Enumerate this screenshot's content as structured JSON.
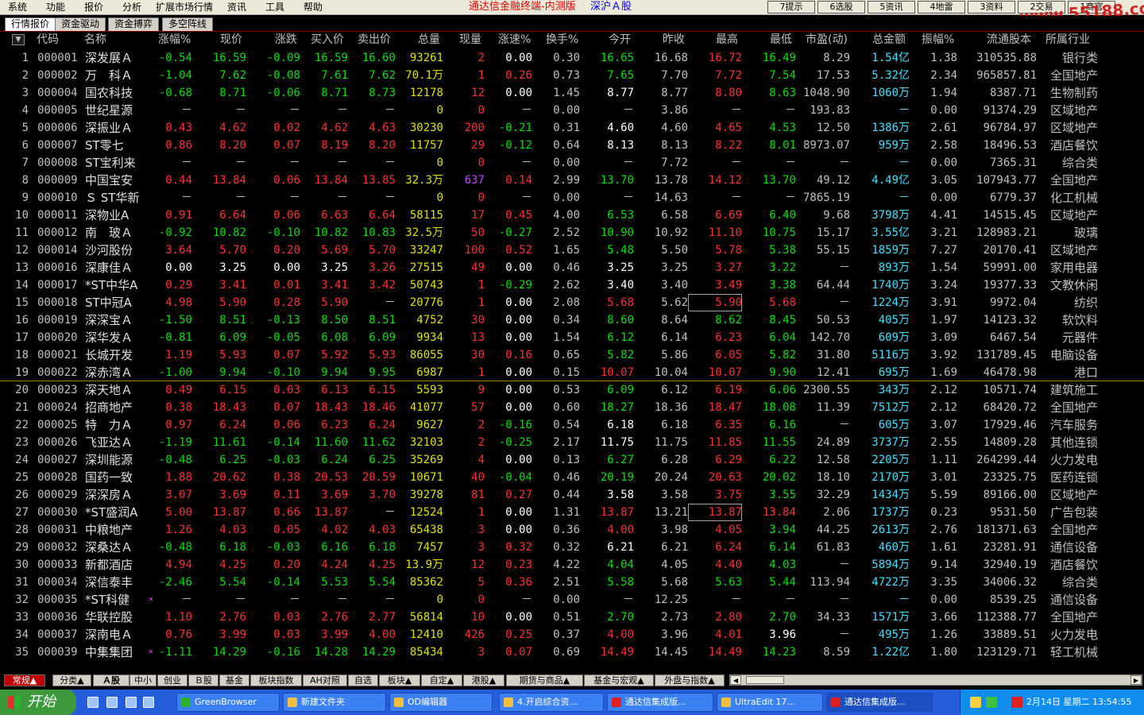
{
  "menu": [
    "系统",
    "功能",
    "报价",
    "分析",
    "扩展市场行情",
    "资讯",
    "工具",
    "帮助"
  ],
  "app_title": "通达信金融终端-内测版",
  "app_market": "深沪Ａ股",
  "top_buttons": [
    "7提示",
    "6选股",
    "5资讯",
    "4地雷",
    "3资料",
    "2交易",
    "1商官"
  ],
  "watermark": "www.55188.com",
  "top_tabs": [
    "行情报价",
    "资金驱动",
    "资金搏弈",
    "多空阵线"
  ],
  "columns": [
    "代码",
    "名称",
    "涨幅%",
    "现价",
    "涨跌",
    "买入价",
    "卖出价",
    "总量",
    "现量",
    "涨速%",
    "换手%",
    "今开",
    "昨收",
    "最高",
    "最低",
    "市盈(动)",
    "总金额",
    "振幅%",
    "流通股本",
    "所属行业"
  ],
  "sort_icon": "▼",
  "rows": [
    [
      "1",
      "000001",
      "深发展Ａ",
      "",
      "-0.54",
      "16.59",
      "-0.09",
      "16.59",
      "16.60",
      "93261",
      "2",
      "0.00",
      "0.30",
      "16.65",
      "16.68",
      "16.72",
      "16.49",
      "8.29",
      "1.54亿",
      "1.38",
      "310535.88",
      "银行类"
    ],
    [
      "2",
      "000002",
      "万　科Ａ",
      "",
      "-1.04",
      "7.62",
      "-0.08",
      "7.61",
      "7.62",
      "70.1万",
      "1",
      "0.26",
      "0.73",
      "7.65",
      "7.70",
      "7.72",
      "7.54",
      "17.53",
      "5.32亿",
      "2.34",
      "965857.81",
      "全国地产"
    ],
    [
      "3",
      "000004",
      "国农科技",
      "",
      "-0.68",
      "8.71",
      "-0.06",
      "8.71",
      "8.73",
      "12178",
      "12",
      "0.00",
      "1.45",
      "8.77",
      "8.77",
      "8.80",
      "8.63",
      "1048.90",
      "1060万",
      "1.94",
      "8387.71",
      "生物制药"
    ],
    [
      "4",
      "000005",
      "世纪星源",
      "",
      "－",
      "－",
      "－",
      "－",
      "－",
      "0",
      "0",
      "－",
      "0.00",
      "－",
      "3.86",
      "－",
      "－",
      "193.83",
      "－",
      "0.00",
      "91374.29",
      "区域地产"
    ],
    [
      "5",
      "000006",
      "深振业Ａ",
      "",
      "0.43",
      "4.62",
      "0.02",
      "4.62",
      "4.63",
      "30230",
      "200",
      "-0.21",
      "0.31",
      "4.60",
      "4.60",
      "4.65",
      "4.53",
      "12.50",
      "1386万",
      "2.61",
      "96784.97",
      "区域地产"
    ],
    [
      "6",
      "000007",
      "ST零七",
      "",
      "0.86",
      "8.20",
      "0.07",
      "8.19",
      "8.20",
      "11757",
      "29",
      "-0.12",
      "0.64",
      "8.13",
      "8.13",
      "8.22",
      "8.01",
      "8973.07",
      "959万",
      "2.58",
      "18496.53",
      "酒店餐饮"
    ],
    [
      "7",
      "000008",
      "ST宝利来",
      "",
      "－",
      "－",
      "－",
      "－",
      "－",
      "0",
      "0",
      "－",
      "0.00",
      "－",
      "7.72",
      "－",
      "－",
      "－",
      "－",
      "0.00",
      "7365.31",
      "综合类"
    ],
    [
      "8",
      "000009",
      "中国宝安",
      "",
      "0.44",
      "13.84",
      "0.06",
      "13.84",
      "13.85",
      "32.3万",
      "637",
      "0.14",
      "2.99",
      "13.70",
      "13.78",
      "14.12",
      "13.70",
      "49.12",
      "4.49亿",
      "3.05",
      "107943.77",
      "全国地产"
    ],
    [
      "9",
      "000010",
      "Ｓ ST华新",
      "",
      "－",
      "－",
      "－",
      "－",
      "－",
      "0",
      "0",
      "－",
      "0.00",
      "－",
      "14.63",
      "－",
      "－",
      "7865.19",
      "－",
      "0.00",
      "6779.37",
      "化工机械"
    ],
    [
      "10",
      "000011",
      "深物业A",
      "",
      "0.91",
      "6.64",
      "0.06",
      "6.63",
      "6.64",
      "58115",
      "17",
      "0.45",
      "4.00",
      "6.53",
      "6.58",
      "6.69",
      "6.40",
      "9.68",
      "3798万",
      "4.41",
      "14515.45",
      "区域地产"
    ],
    [
      "11",
      "000012",
      "南　玻Ａ",
      "",
      "-0.92",
      "10.82",
      "-0.10",
      "10.82",
      "10.83",
      "32.5万",
      "50",
      "-0.27",
      "2.52",
      "10.90",
      "10.92",
      "11.10",
      "10.75",
      "15.17",
      "3.55亿",
      "3.21",
      "128983.21",
      "玻璃"
    ],
    [
      "12",
      "000014",
      "沙河股份",
      "",
      "3.64",
      "5.70",
      "0.20",
      "5.69",
      "5.70",
      "33247",
      "100",
      "0.52",
      "1.65",
      "5.48",
      "5.50",
      "5.78",
      "5.38",
      "55.15",
      "1859万",
      "7.27",
      "20170.41",
      "区域地产"
    ],
    [
      "13",
      "000016",
      "深康佳Ａ",
      "",
      "0.00",
      "3.25",
      "0.00",
      "3.25",
      "3.26",
      "27515",
      "49",
      "0.00",
      "0.46",
      "3.25",
      "3.25",
      "3.27",
      "3.22",
      "－",
      "893万",
      "1.54",
      "59991.00",
      "家用电器"
    ],
    [
      "14",
      "000017",
      "*ST中华A",
      "",
      "0.29",
      "3.41",
      "0.01",
      "3.41",
      "3.42",
      "50743",
      "1",
      "-0.29",
      "2.62",
      "3.40",
      "3.40",
      "3.49",
      "3.38",
      "64.44",
      "1740万",
      "3.24",
      "19377.33",
      "文教休闲"
    ],
    [
      "15",
      "000018",
      "ST中冠A",
      "",
      "4.98",
      "5.90",
      "0.28",
      "5.90",
      "－",
      "20776",
      "1",
      "0.00",
      "2.08",
      "5.68",
      "5.62",
      "5.90",
      "5.68",
      "－",
      "1224万",
      "3.91",
      "9972.04",
      "纺织"
    ],
    [
      "16",
      "000019",
      "深深宝Ａ",
      "",
      "-1.50",
      "8.51",
      "-0.13",
      "8.50",
      "8.51",
      "4752",
      "30",
      "0.00",
      "0.34",
      "8.60",
      "8.64",
      "8.62",
      "8.45",
      "50.53",
      "405万",
      "1.97",
      "14123.32",
      "软饮料"
    ],
    [
      "17",
      "000020",
      "深华发Ａ",
      "",
      "-0.81",
      "6.09",
      "-0.05",
      "6.08",
      "6.09",
      "9934",
      "13",
      "0.00",
      "1.54",
      "6.12",
      "6.14",
      "6.23",
      "6.04",
      "142.70",
      "609万",
      "3.09",
      "6467.54",
      "元器件"
    ],
    [
      "18",
      "000021",
      "长城开发",
      "",
      "1.19",
      "5.93",
      "0.07",
      "5.92",
      "5.93",
      "86055",
      "30",
      "0.16",
      "0.65",
      "5.82",
      "5.86",
      "6.05",
      "5.82",
      "31.80",
      "5116万",
      "3.92",
      "131789.45",
      "电脑设备"
    ],
    [
      "19",
      "000022",
      "深赤湾Ａ",
      "",
      "-1.00",
      "9.94",
      "-0.10",
      "9.94",
      "9.95",
      "6987",
      "1",
      "0.00",
      "0.15",
      "10.07",
      "10.04",
      "10.07",
      "9.90",
      "12.41",
      "695万",
      "1.69",
      "46478.98",
      "港口"
    ],
    [
      "20",
      "000023",
      "深天地Ａ",
      "",
      "0.49",
      "6.15",
      "0.03",
      "6.13",
      "6.15",
      "5593",
      "9",
      "0.00",
      "0.53",
      "6.09",
      "6.12",
      "6.19",
      "6.06",
      "2300.55",
      "343万",
      "2.12",
      "10571.74",
      "建筑施工"
    ],
    [
      "21",
      "000024",
      "招商地产",
      "",
      "0.38",
      "18.43",
      "0.07",
      "18.43",
      "18.46",
      "41077",
      "57",
      "0.00",
      "0.60",
      "18.27",
      "18.36",
      "18.47",
      "18.08",
      "11.39",
      "7512万",
      "2.12",
      "68420.72",
      "全国地产"
    ],
    [
      "22",
      "000025",
      "特　力Ａ",
      "",
      "0.97",
      "6.24",
      "0.06",
      "6.23",
      "6.24",
      "9627",
      "2",
      "-0.16",
      "0.54",
      "6.18",
      "6.18",
      "6.35",
      "6.16",
      "－",
      "605万",
      "3.07",
      "17929.46",
      "汽车服务"
    ],
    [
      "23",
      "000026",
      "飞亚达Ａ",
      "",
      "-1.19",
      "11.61",
      "-0.14",
      "11.60",
      "11.62",
      "32103",
      "2",
      "-0.25",
      "2.17",
      "11.75",
      "11.75",
      "11.85",
      "11.55",
      "24.89",
      "3737万",
      "2.55",
      "14809.28",
      "其他连锁"
    ],
    [
      "24",
      "000027",
      "深圳能源",
      "",
      "-0.48",
      "6.25",
      "-0.03",
      "6.24",
      "6.25",
      "35269",
      "4",
      "0.00",
      "0.13",
      "6.27",
      "6.28",
      "6.29",
      "6.22",
      "12.58",
      "2205万",
      "1.11",
      "264299.44",
      "火力发电"
    ],
    [
      "25",
      "000028",
      "国药一致",
      "",
      "1.88",
      "20.62",
      "0.38",
      "20.53",
      "20.59",
      "10671",
      "40",
      "-0.04",
      "0.46",
      "20.19",
      "20.24",
      "20.63",
      "20.02",
      "18.10",
      "2170万",
      "3.01",
      "23325.75",
      "医药连锁"
    ],
    [
      "26",
      "000029",
      "深深房Ａ",
      "",
      "3.07",
      "3.69",
      "0.11",
      "3.69",
      "3.70",
      "39278",
      "81",
      "0.27",
      "0.44",
      "3.58",
      "3.58",
      "3.75",
      "3.55",
      "32.29",
      "1434万",
      "5.59",
      "89166.00",
      "区域地产"
    ],
    [
      "27",
      "000030",
      "*ST盛润A",
      "",
      "5.00",
      "13.87",
      "0.66",
      "13.87",
      "－",
      "12524",
      "1",
      "0.00",
      "1.31",
      "13.87",
      "13.21",
      "13.87",
      "13.84",
      "2.06",
      "1737万",
      "0.23",
      "9531.50",
      "广告包装"
    ],
    [
      "28",
      "000031",
      "中粮地产",
      "",
      "1.26",
      "4.03",
      "0.05",
      "4.02",
      "4.03",
      "65438",
      "3",
      "0.00",
      "0.36",
      "4.00",
      "3.98",
      "4.05",
      "3.94",
      "44.25",
      "2613万",
      "2.76",
      "181371.63",
      "全国地产"
    ],
    [
      "29",
      "000032",
      "深桑达Ａ",
      "",
      "-0.48",
      "6.18",
      "-0.03",
      "6.16",
      "6.18",
      "7457",
      "3",
      "0.32",
      "0.32",
      "6.21",
      "6.21",
      "6.24",
      "6.14",
      "61.83",
      "460万",
      "1.61",
      "23281.91",
      "通信设备"
    ],
    [
      "30",
      "000033",
      "新都酒店",
      "",
      "4.94",
      "4.25",
      "0.20",
      "4.24",
      "4.25",
      "13.9万",
      "12",
      "0.23",
      "4.22",
      "4.04",
      "4.05",
      "4.40",
      "4.03",
      "－",
      "5894万",
      "9.14",
      "32940.19",
      "酒店餐饮"
    ],
    [
      "31",
      "000034",
      "深信泰丰",
      "",
      "-2.46",
      "5.54",
      "-0.14",
      "5.53",
      "5.54",
      "85362",
      "5",
      "0.36",
      "2.51",
      "5.58",
      "5.68",
      "5.63",
      "5.44",
      "113.94",
      "4722万",
      "3.35",
      "34006.32",
      "综合类"
    ],
    [
      "32",
      "000035",
      "*ST科健",
      "×",
      "－",
      "－",
      "－",
      "－",
      "－",
      "0",
      "0",
      "－",
      "0.00",
      "－",
      "12.25",
      "－",
      "－",
      "－",
      "－",
      "0.00",
      "8539.25",
      "通信设备"
    ],
    [
      "33",
      "000036",
      "华联控股",
      "",
      "1.10",
      "2.76",
      "0.03",
      "2.76",
      "2.77",
      "56814",
      "10",
      "0.00",
      "0.51",
      "2.70",
      "2.73",
      "2.80",
      "2.70",
      "34.33",
      "1571万",
      "3.66",
      "112388.77",
      "全国地产"
    ],
    [
      "34",
      "000037",
      "深南电Ａ",
      "",
      "0.76",
      "3.99",
      "0.03",
      "3.99",
      "4.00",
      "12410",
      "426",
      "0.25",
      "0.37",
      "4.00",
      "3.96",
      "4.01",
      "3.96",
      "－",
      "495万",
      "1.26",
      "33889.51",
      "火力发电"
    ],
    [
      "35",
      "000039",
      "中集集团",
      "×",
      "-1.11",
      "14.29",
      "-0.16",
      "14.28",
      "14.29",
      "85434",
      "3",
      "0.07",
      "0.69",
      "14.49",
      "14.45",
      "14.49",
      "14.23",
      "8.59",
      "1.22亿",
      "1.80",
      "123129.71",
      "轻工机械"
    ]
  ],
  "bottom_tabs": [
    "常规▲",
    "分类▲",
    "Ａ股",
    "中小",
    "创业",
    "Ｂ股",
    "基金",
    "板块指数",
    "AH对照",
    "自选",
    "板块▲",
    "自定▲",
    "港股▲",
    "期货与商品▲",
    "基金与宏观▲",
    "外盘与指数▲"
  ],
  "taskbar": {
    "start": "开始",
    "tasks": [
      "GreenBrowser",
      "新建文件夹",
      "OD编辑器",
      "4.开启综合资...",
      "通达信集成版...",
      "UltraEdit 17...",
      "通达信集成版..."
    ],
    "clock": "2月14日 星期二 13:54:55"
  },
  "colors": {
    "up": "#ff3030",
    "down": "#00e000",
    "flat": "#ffffff",
    "amount": "#40e0ff",
    "volume": "#e0e000",
    "current_vol": "#ff3030",
    "purple": "#c040ff"
  }
}
